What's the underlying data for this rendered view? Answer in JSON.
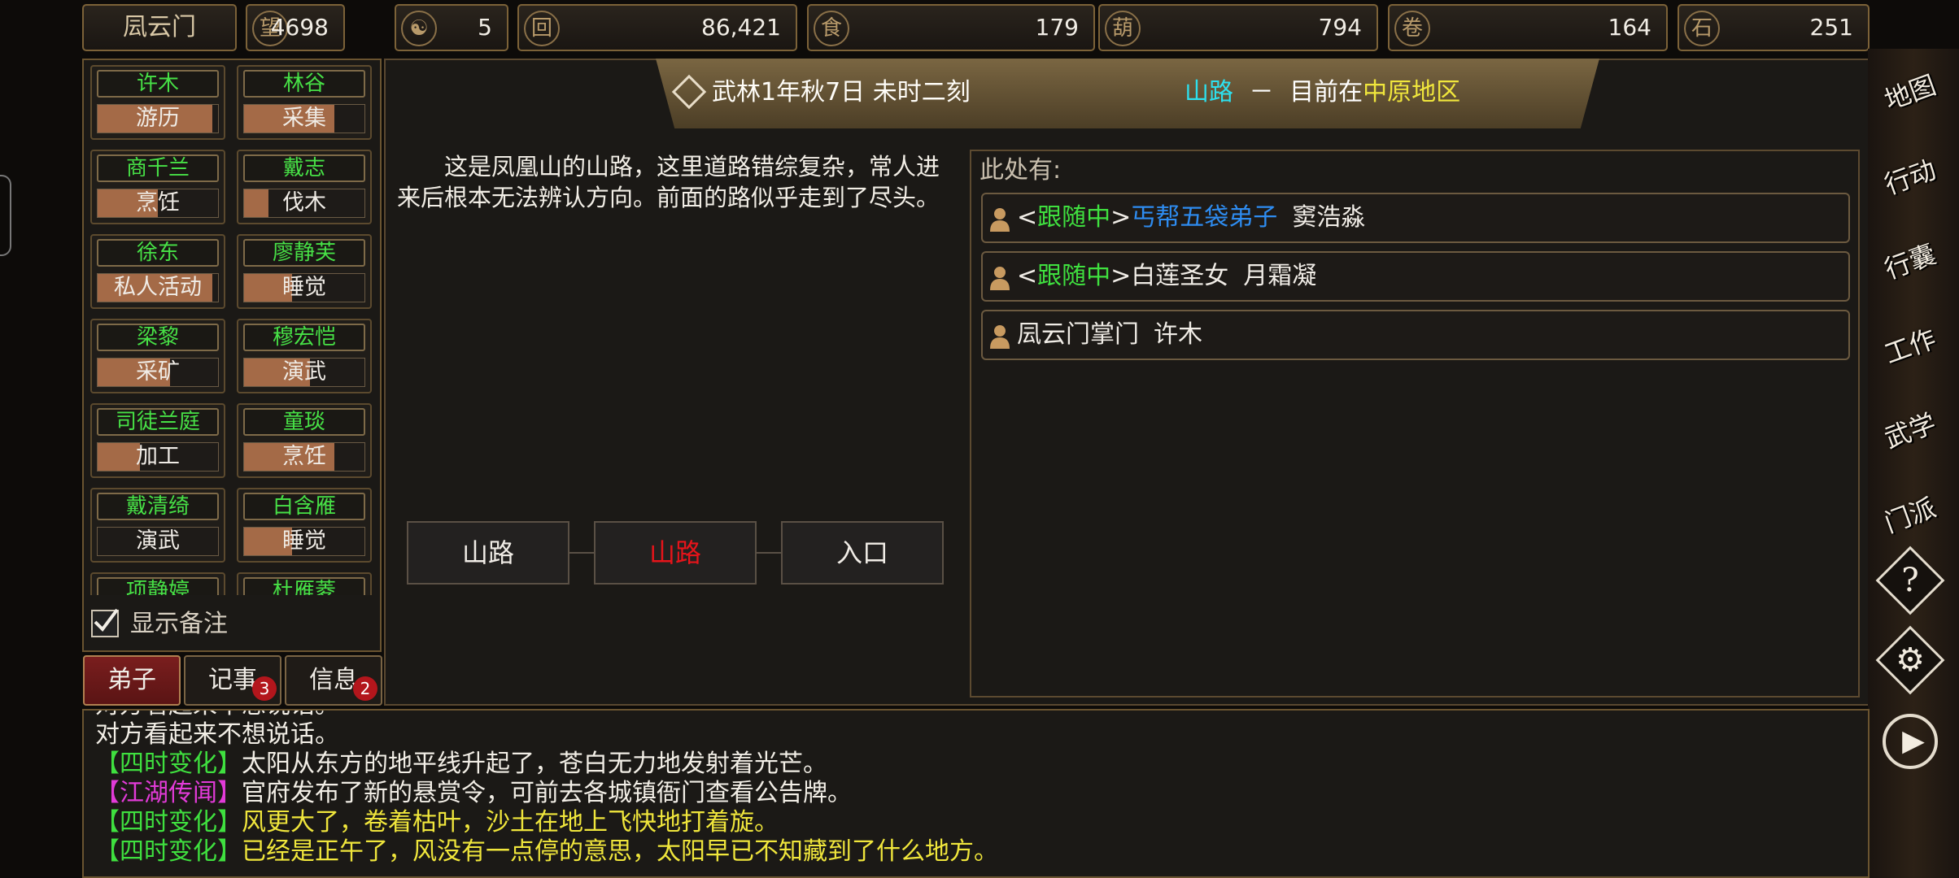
{
  "sect_name": "凨云门",
  "resources": [
    {
      "icon": "prestige-icon",
      "glyph": "望",
      "value": "4698"
    },
    {
      "icon": "yin-yang-icon",
      "glyph": "☯",
      "value": "5"
    },
    {
      "icon": "coin-icon",
      "glyph": "回",
      "value": "86,421"
    },
    {
      "icon": "food-bowl-icon",
      "glyph": "食",
      "value": "179"
    },
    {
      "icon": "gourd-icon",
      "glyph": "葫",
      "value": "794"
    },
    {
      "icon": "scroll-icon",
      "glyph": "卷",
      "value": "164"
    },
    {
      "icon": "ore-icon",
      "glyph": "石",
      "value": "251"
    }
  ],
  "disciples": [
    {
      "name": "许木",
      "activity": "游历",
      "progress": 0.95
    },
    {
      "name": "林谷",
      "activity": "采集",
      "progress": 0.75
    },
    {
      "name": "商千兰",
      "activity": "烹饪",
      "progress": 0.5
    },
    {
      "name": "戴志",
      "activity": "伐木",
      "progress": 0.2
    },
    {
      "name": "徐东",
      "activity": "私人活动",
      "progress": 0.95
    },
    {
      "name": "廖静芙",
      "activity": "睡觉",
      "progress": 0.4
    },
    {
      "name": "梁黎",
      "activity": "采矿",
      "progress": 0.6
    },
    {
      "name": "穆宏恺",
      "activity": "演武",
      "progress": 0.55
    },
    {
      "name": "司徒兰庭",
      "activity": "加工",
      "progress": 0.35
    },
    {
      "name": "童琰",
      "activity": "烹饪",
      "progress": 0.75
    },
    {
      "name": "戴清绮",
      "activity": "演武",
      "progress": 0.0
    },
    {
      "name": "白含雁",
      "activity": "睡觉",
      "progress": 0.4
    },
    {
      "name": "项静婷",
      "activity": "",
      "progress": 0
    },
    {
      "name": "杜雁菱",
      "activity": "",
      "progress": 0
    }
  ],
  "show_notes_label": "显示备注",
  "tabs": [
    {
      "label": "弟子",
      "badge": ""
    },
    {
      "label": "记事",
      "badge": "3"
    },
    {
      "label": "信息",
      "badge": "2"
    }
  ],
  "header": {
    "date": "武林1年秋7日 未时二刻",
    "place": "山路",
    "sep": "－",
    "current_prefix": "目前在",
    "region": "中原地区"
  },
  "description": "这是凤凰山的山路，这里道路错综复杂，常人进来后根本无法辨认方向。前面的路似乎走到了尽头。",
  "locations": [
    {
      "label": "山路",
      "current": false
    },
    {
      "label": "山路",
      "current": true
    },
    {
      "label": "入口",
      "current": false
    }
  ],
  "here_label": "此处有:",
  "npcs": [
    {
      "status_open": "<",
      "status": "跟随中",
      "status_close": ">",
      "title": "丐帮五袋弟子",
      "name": "窦浩淼"
    },
    {
      "status_open": "<",
      "status": "跟随中",
      "status_close": ">",
      "title": "白莲圣女",
      "name": "月霜凝"
    },
    {
      "status_open": "",
      "status": "",
      "status_close": "",
      "title": "凨云门掌门",
      "name": "许木"
    }
  ],
  "side_menu": [
    {
      "label": "地图",
      "icon": "map-icon"
    },
    {
      "label": "行动",
      "icon": "action-icon"
    },
    {
      "label": "行囊",
      "icon": "bag-icon"
    },
    {
      "label": "工作",
      "icon": "work-icon"
    },
    {
      "label": "武学",
      "icon": "martial-icon"
    },
    {
      "label": "门派",
      "icon": "sect-icon"
    },
    {
      "label": "?",
      "icon": "help-icon"
    },
    {
      "label": "⚙",
      "icon": "settings-icon"
    },
    {
      "label": "▶",
      "icon": "play-icon"
    }
  ],
  "log": [
    {
      "tag": "",
      "text": "对方看起来不想说话。"
    },
    {
      "tag": "",
      "text": "对方看起来不想说话。"
    },
    {
      "tag": "【四时变化】",
      "text": "太阳从东方的地平线升起了，苍白无力地发射着光芒。"
    },
    {
      "tag": "【江湖传闻】",
      "text": "官府发布了新的悬赏令，可前去各城镇衙门查看公告牌。"
    },
    {
      "tag": "【四时变化】",
      "text": "风更大了，卷着枯叶，沙土在地上飞快地打着旋。"
    },
    {
      "tag": "【四时变化】",
      "text": "已经是正午了，风没有一点停的意思，太阳早已不知藏到了什么地方。"
    }
  ],
  "colors": {
    "name_green": "#47e046",
    "status_green": "#3fe03f",
    "title_blue": "#2e8cf0",
    "place_cyan": "#2de0ee",
    "region_yellow": "#f0e63c",
    "season_tag_green": "#3fe03f",
    "rumor_tag_magenta": "#e23bd8",
    "current_location_red": "#e6141a"
  }
}
